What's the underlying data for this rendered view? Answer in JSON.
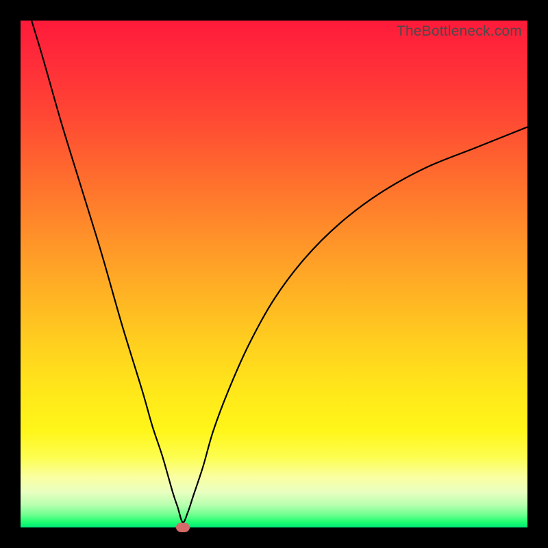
{
  "watermark": "TheBottleneck.com",
  "colors": {
    "frame": "#000000",
    "curve": "#000000",
    "marker": "#d46a6a",
    "gradient_top": "#ff1a3a",
    "gradient_bottom": "#00e878"
  },
  "chart_data": {
    "type": "line",
    "title": "",
    "xlabel": "",
    "ylabel": "",
    "xlim": [
      0,
      100
    ],
    "ylim": [
      0,
      100
    ],
    "grid": false,
    "legend": false,
    "annotations": [
      "TheBottleneck.com"
    ],
    "marker": {
      "x": 32,
      "y": 0,
      "kind": "min-point"
    },
    "series": [
      {
        "name": "bottleneck-curve",
        "x": [
          0,
          4,
          8,
          12,
          16,
          20,
          24,
          26,
          28,
          30,
          31,
          32,
          33,
          34,
          36,
          38,
          41,
          45,
          50,
          56,
          63,
          71,
          80,
          90,
          100
        ],
        "y": [
          107,
          94,
          80,
          67,
          54,
          40,
          27,
          20,
          14,
          7,
          4,
          1,
          3,
          6,
          12,
          19,
          27,
          36,
          45,
          53,
          60,
          66,
          71,
          75,
          79
        ]
      }
    ]
  }
}
